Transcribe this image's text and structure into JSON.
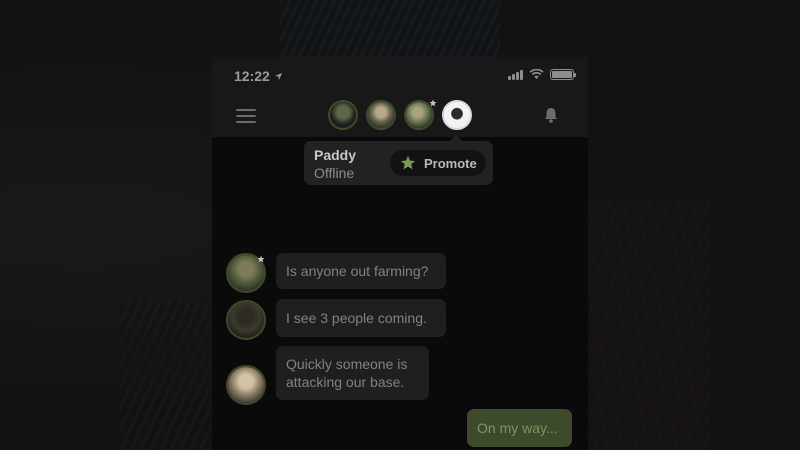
{
  "status_bar": {
    "time": "12:22",
    "icons": [
      "location-arrow-icon",
      "signal-icon",
      "wifi-icon",
      "battery-icon"
    ]
  },
  "header": {
    "menu_icon": "menu-icon",
    "bell_icon": "bell-icon",
    "avatars": [
      {
        "name": "avatar-1",
        "selected": false
      },
      {
        "name": "avatar-2",
        "selected": false
      },
      {
        "name": "avatar-3",
        "selected": false,
        "badge": "star"
      },
      {
        "name": "avatar-paddy",
        "selected": true
      }
    ]
  },
  "popover": {
    "name": "Paddy",
    "status": "Offline",
    "promote_label": "Promote",
    "promote_icon": "star-icon"
  },
  "messages": [
    {
      "direction": "incoming",
      "text": "Is anyone out farming?",
      "avatar_badge": "star"
    },
    {
      "direction": "incoming",
      "text": "I see 3 people coming."
    },
    {
      "direction": "incoming",
      "text": "Quickly someone is attacking our base."
    },
    {
      "direction": "outgoing",
      "text": "On my way..."
    }
  ],
  "colors": {
    "accent_green": "#3e4a2c",
    "accent_green_text": "#7e9560",
    "star_green": "#7c9a52",
    "background": "#0a0a0a"
  }
}
